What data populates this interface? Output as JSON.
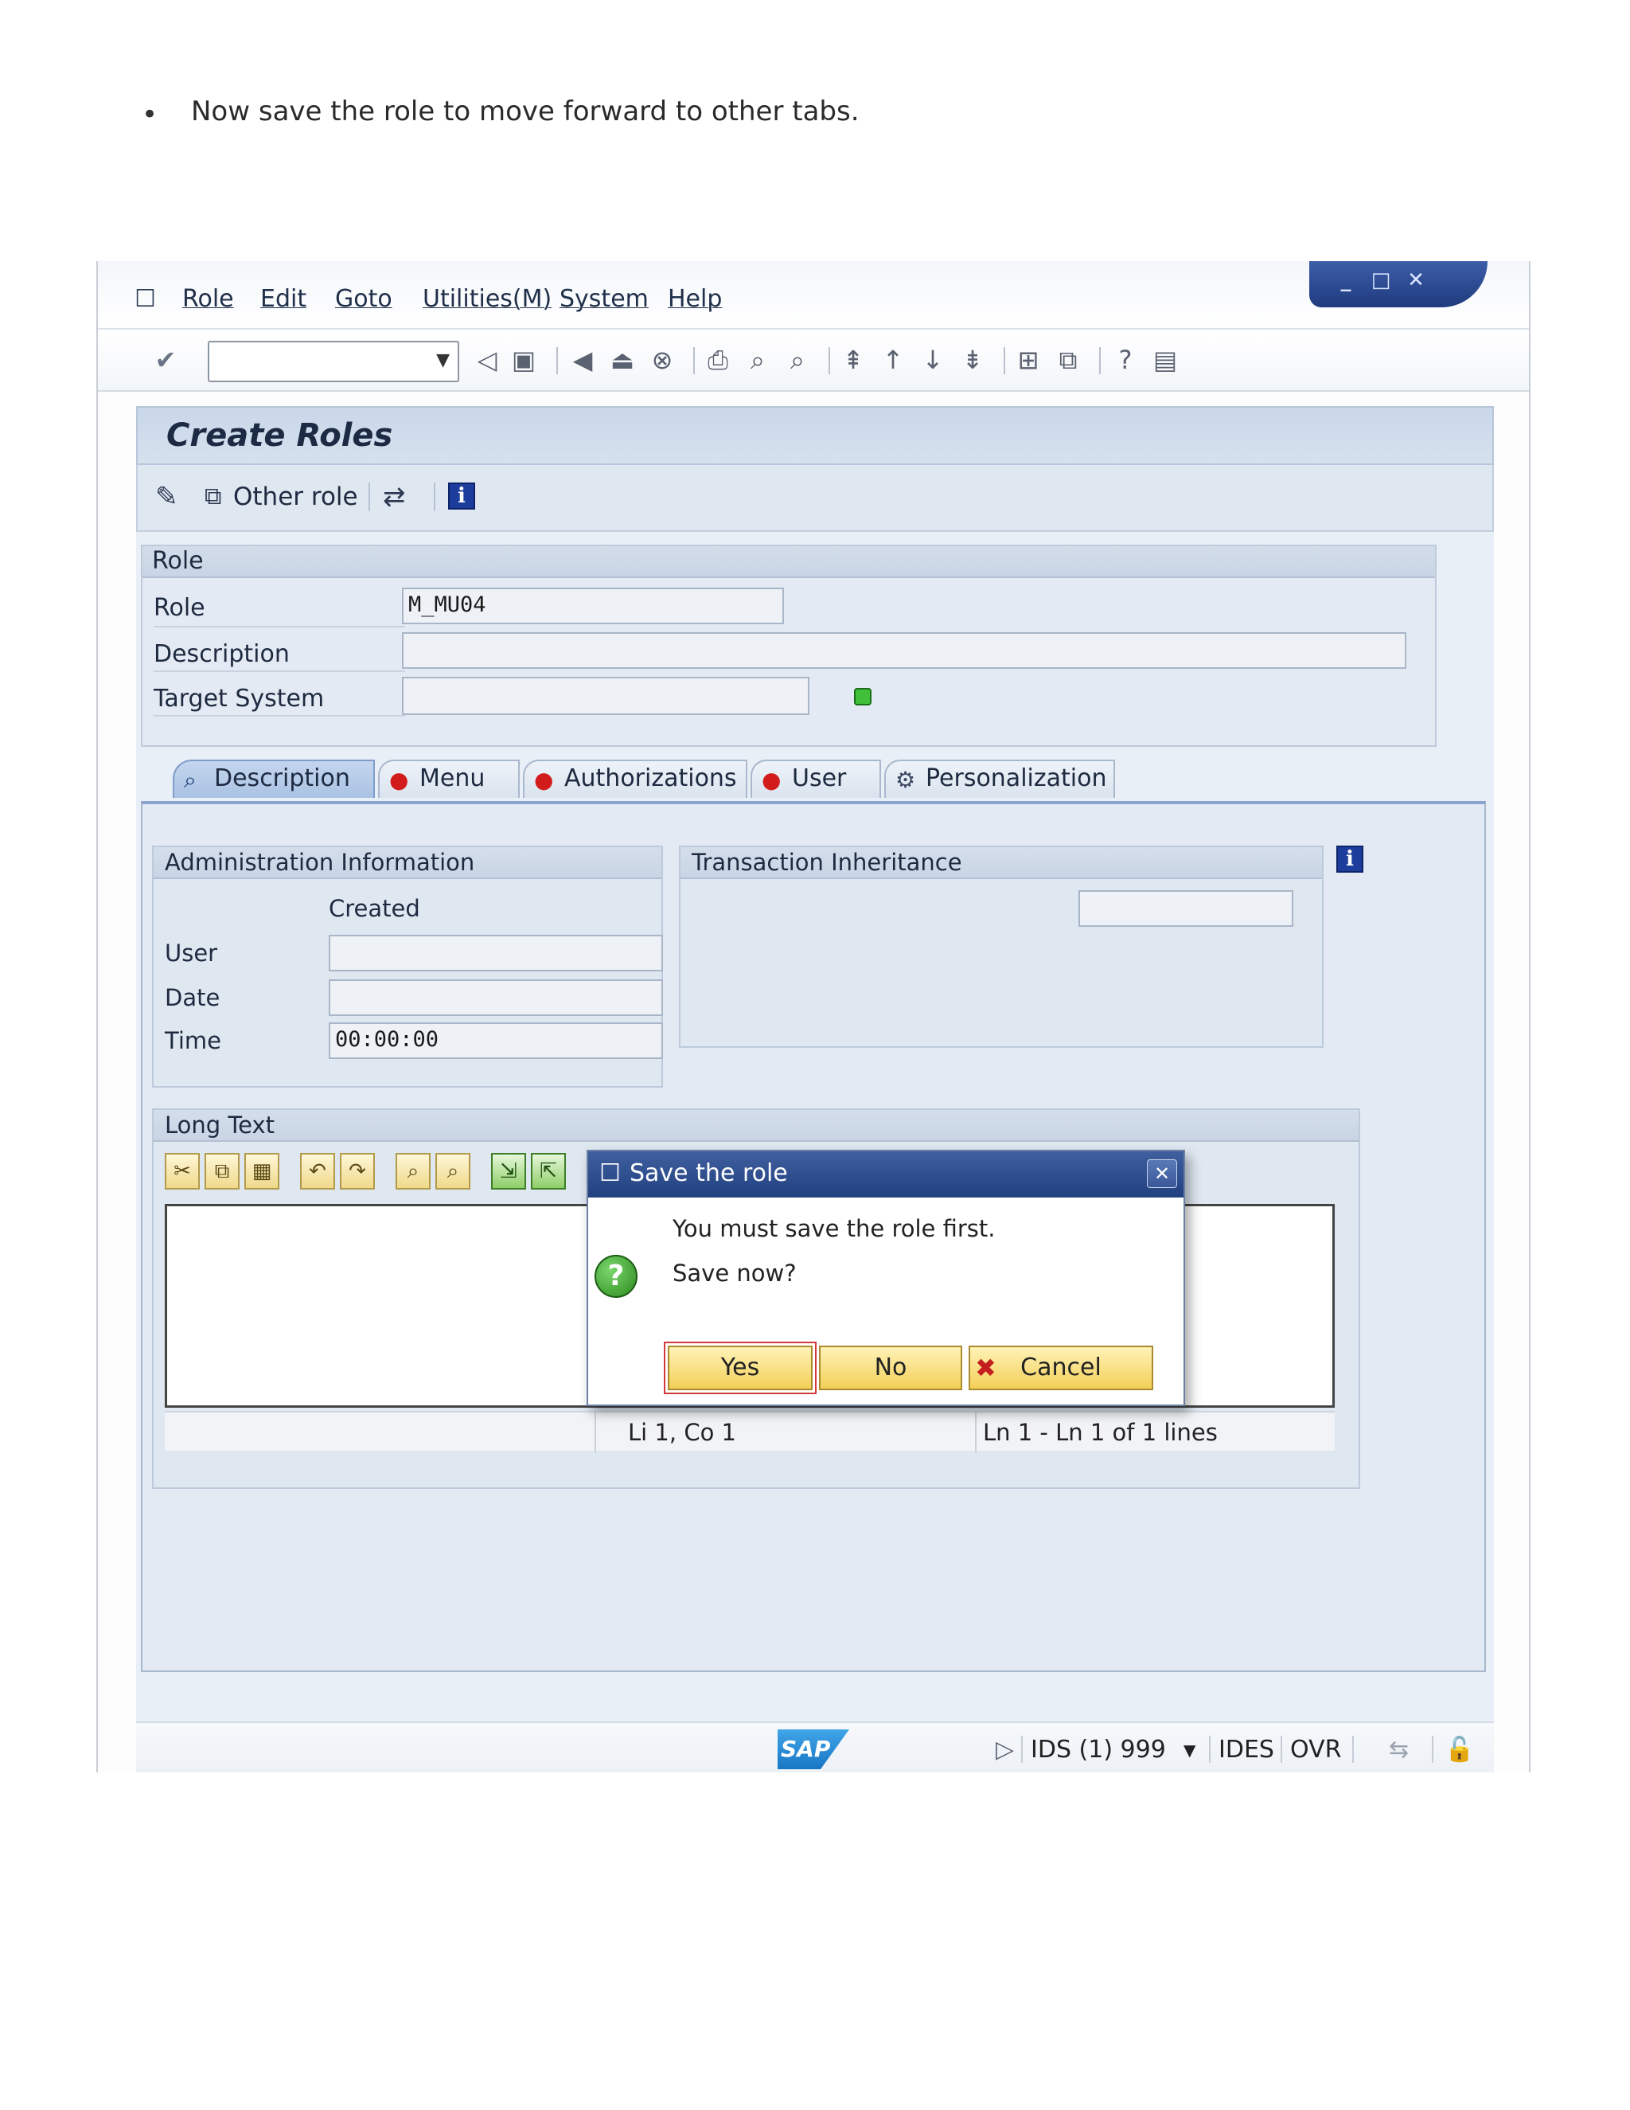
{
  "document": {
    "bullet": "•",
    "instruction": "Now save the role to move forward to other tabs."
  },
  "menu": {
    "items": [
      "Role",
      "Edit",
      "Goto",
      "Utilities(M)",
      "System",
      "Help"
    ]
  },
  "window_controls": {
    "minimize": "_",
    "maximize": "□",
    "close": "✕"
  },
  "toolbar": {
    "command_field_value": ""
  },
  "screen": {
    "title": "Create Roles",
    "other_role_label": "Other role",
    "info_label": "i"
  },
  "role_group": {
    "header": "Role",
    "role_label": "Role",
    "role_value": "M_MU04",
    "description_label": "Description",
    "description_value": "",
    "target_system_label": "Target System",
    "target_system_value": "",
    "status_color": "#3fbf3a"
  },
  "tabs": [
    {
      "label": "Description",
      "active": true
    },
    {
      "label": "Menu",
      "active": false
    },
    {
      "label": "Authorizations",
      "active": false
    },
    {
      "label": "User",
      "active": false
    },
    {
      "label": "Personalization",
      "active": false
    }
  ],
  "admin_info": {
    "header": "Administration Information",
    "column_created": "Created",
    "user_label": "User",
    "date_label": "Date",
    "time_label": "Time",
    "time_value": "00:00:00"
  },
  "transaction_inheritance": {
    "header": "Transaction Inheritance"
  },
  "long_text": {
    "header": "Long Text",
    "status_position": "Li 1, Co 1",
    "status_lines": "Ln 1 - Ln 1 of 1 lines"
  },
  "dialog": {
    "title": "Save the role",
    "message_line1": "You must save the role first.",
    "message_line2": "Save now?",
    "yes_label": "Yes",
    "no_label": "No",
    "cancel_label": "Cancel"
  },
  "statusbar": {
    "logo": "SAP",
    "system": "IDS (1) 999",
    "client": "IDES",
    "mode": "OVR"
  }
}
